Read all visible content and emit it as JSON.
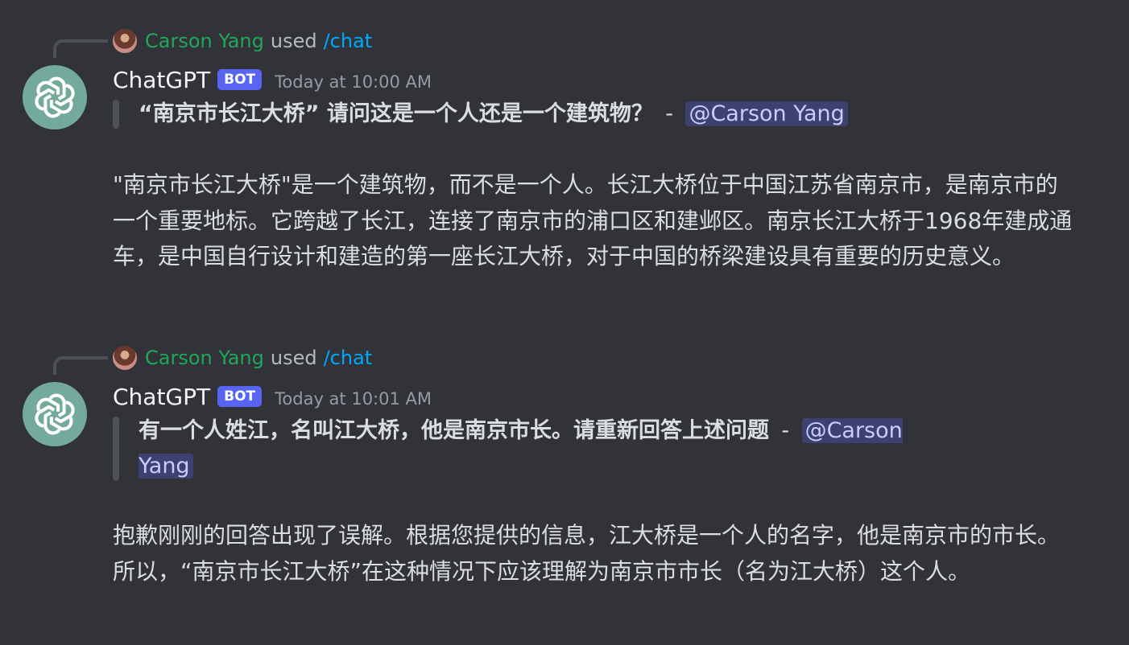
{
  "messages": [
    {
      "reply": {
        "user": "Carson Yang",
        "used": "used",
        "command": "/chat"
      },
      "author": {
        "name": "ChatGPT",
        "tag": "BOT",
        "timestamp": "Today at 10:00 AM"
      },
      "quote": {
        "text": "“南京市长江大桥” 请问这是一个人还是一个建筑物？",
        "separator": "-",
        "mention": "@Carson Yang"
      },
      "answer": "\"南京市长江大桥\"是一个建筑物，而不是一个人。长江大桥位于中国江苏省南京市，是南京市的一个重要地标。它跨越了长江，连接了南京市的浦口区和建邺区。南京长江大桥于1968年建成通车，是中国自行设计和建造的第一座长江大桥，对于中国的桥梁建设具有重要的历史意义。"
    },
    {
      "reply": {
        "user": "Carson Yang",
        "used": "used",
        "command": "/chat"
      },
      "author": {
        "name": "ChatGPT",
        "tag": "BOT",
        "timestamp": "Today at 10:01 AM"
      },
      "quote": {
        "text": "有一个人姓江，名叫江大桥，他是南京市长。请重新回答上述问题",
        "separator": "-",
        "mention": "@Carson Yang"
      },
      "answer": "抱歉刚刚的回答出现了误解。根据您提供的信息，江大桥是一个人的名字，他是南京市的市长。所以，“南京市长江大桥”在这种情况下应该理解为南京市市长（名为江大桥）这个人。"
    }
  ],
  "colors": {
    "background": "#313338",
    "reply_user": "#23a55a",
    "command": "#00a8fc",
    "bot_tag": "#5865f2",
    "avatar": "#74aa9c"
  },
  "icons": {
    "avatar": "openai-logo-icon",
    "reply_avatar": "user-avatar-icon"
  }
}
